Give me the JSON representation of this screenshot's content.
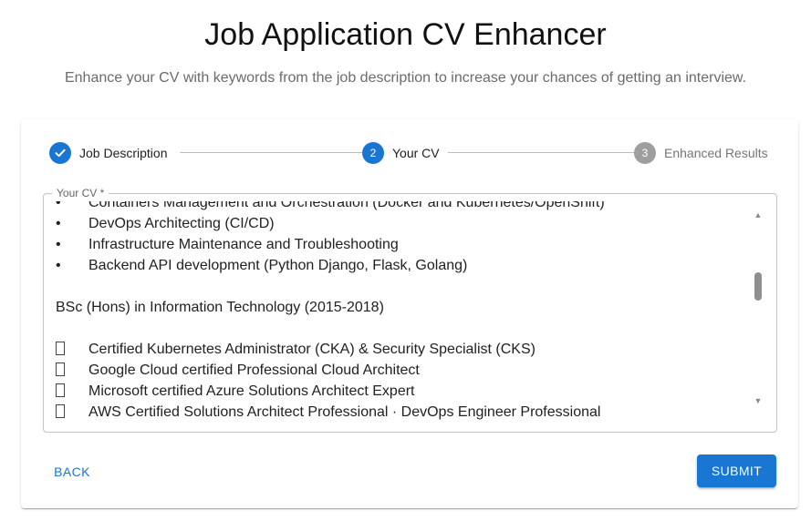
{
  "header": {
    "title": "Job Application CV Enhancer",
    "subtitle": "Enhance your CV with keywords from the job description to increase your chances of getting an interview."
  },
  "stepper": {
    "steps": [
      {
        "number": "",
        "label": "Job Description",
        "state": "completed",
        "icon": "check-icon"
      },
      {
        "number": "2",
        "label": "Your CV",
        "state": "active"
      },
      {
        "number": "3",
        "label": "Enhanced Results",
        "state": "pending"
      }
    ]
  },
  "cv_field": {
    "label": "Your CV *",
    "lines": [
      {
        "bullet": "•",
        "text": "Containers Management and Orchestration (Docker and Kubernetes/OpenShift)"
      },
      {
        "bullet": "•",
        "text": "DevOps Architecting (CI/CD)"
      },
      {
        "bullet": "•",
        "text": "Infrastructure Maintenance and Troubleshooting"
      },
      {
        "bullet": "•",
        "text": "Backend API development (Python Django, Flask, Golang)"
      },
      {
        "bullet": "",
        "text": ""
      },
      {
        "bullet": "",
        "text": "BSc (Hons) in Information Technology (2015-2018)"
      },
      {
        "bullet": "",
        "text": ""
      },
      {
        "bullet": "",
        "text": "Certified Kubernetes Administrator (CKA) & Security Specialist (CKS)"
      },
      {
        "bullet": "",
        "text": "Google Cloud certified Professional Cloud Architect"
      },
      {
        "bullet": "",
        "text": "Microsoft certified Azure Solutions Architect Expert"
      },
      {
        "bullet": "",
        "text": "AWS Certified Solutions Architect Professional · DevOps Engineer Professional"
      }
    ],
    "scroll_position": 0.3
  },
  "actions": {
    "back_label": "BACK",
    "submit_label": "SUBMIT"
  },
  "colors": {
    "primary": "#1976d2",
    "pending": "#9e9e9e"
  }
}
